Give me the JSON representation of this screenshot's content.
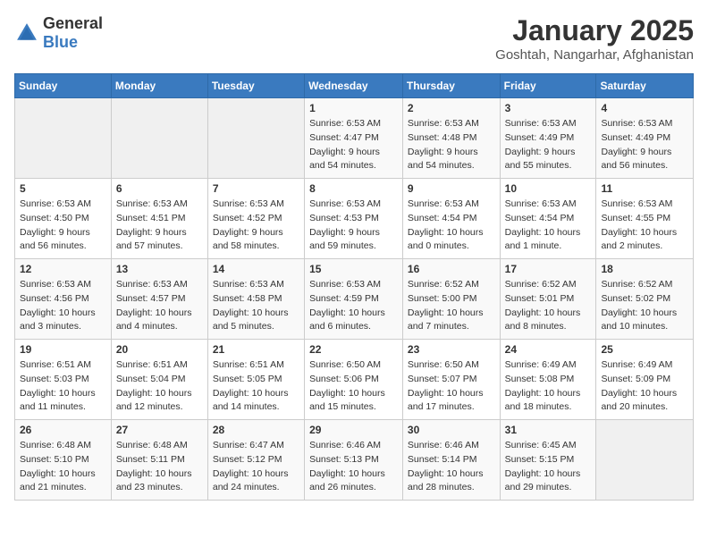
{
  "logo": {
    "general": "General",
    "blue": "Blue"
  },
  "title": "January 2025",
  "subtitle": "Goshtah, Nangarhar, Afghanistan",
  "headers": [
    "Sunday",
    "Monday",
    "Tuesday",
    "Wednesday",
    "Thursday",
    "Friday",
    "Saturday"
  ],
  "weeks": [
    [
      {
        "day": "",
        "info": ""
      },
      {
        "day": "",
        "info": ""
      },
      {
        "day": "",
        "info": ""
      },
      {
        "day": "1",
        "info": "Sunrise: 6:53 AM\nSunset: 4:47 PM\nDaylight: 9 hours\nand 54 minutes."
      },
      {
        "day": "2",
        "info": "Sunrise: 6:53 AM\nSunset: 4:48 PM\nDaylight: 9 hours\nand 54 minutes."
      },
      {
        "day": "3",
        "info": "Sunrise: 6:53 AM\nSunset: 4:49 PM\nDaylight: 9 hours\nand 55 minutes."
      },
      {
        "day": "4",
        "info": "Sunrise: 6:53 AM\nSunset: 4:49 PM\nDaylight: 9 hours\nand 56 minutes."
      }
    ],
    [
      {
        "day": "5",
        "info": "Sunrise: 6:53 AM\nSunset: 4:50 PM\nDaylight: 9 hours\nand 56 minutes."
      },
      {
        "day": "6",
        "info": "Sunrise: 6:53 AM\nSunset: 4:51 PM\nDaylight: 9 hours\nand 57 minutes."
      },
      {
        "day": "7",
        "info": "Sunrise: 6:53 AM\nSunset: 4:52 PM\nDaylight: 9 hours\nand 58 minutes."
      },
      {
        "day": "8",
        "info": "Sunrise: 6:53 AM\nSunset: 4:53 PM\nDaylight: 9 hours\nand 59 minutes."
      },
      {
        "day": "9",
        "info": "Sunrise: 6:53 AM\nSunset: 4:54 PM\nDaylight: 10 hours\nand 0 minutes."
      },
      {
        "day": "10",
        "info": "Sunrise: 6:53 AM\nSunset: 4:54 PM\nDaylight: 10 hours\nand 1 minute."
      },
      {
        "day": "11",
        "info": "Sunrise: 6:53 AM\nSunset: 4:55 PM\nDaylight: 10 hours\nand 2 minutes."
      }
    ],
    [
      {
        "day": "12",
        "info": "Sunrise: 6:53 AM\nSunset: 4:56 PM\nDaylight: 10 hours\nand 3 minutes."
      },
      {
        "day": "13",
        "info": "Sunrise: 6:53 AM\nSunset: 4:57 PM\nDaylight: 10 hours\nand 4 minutes."
      },
      {
        "day": "14",
        "info": "Sunrise: 6:53 AM\nSunset: 4:58 PM\nDaylight: 10 hours\nand 5 minutes."
      },
      {
        "day": "15",
        "info": "Sunrise: 6:53 AM\nSunset: 4:59 PM\nDaylight: 10 hours\nand 6 minutes."
      },
      {
        "day": "16",
        "info": "Sunrise: 6:52 AM\nSunset: 5:00 PM\nDaylight: 10 hours\nand 7 minutes."
      },
      {
        "day": "17",
        "info": "Sunrise: 6:52 AM\nSunset: 5:01 PM\nDaylight: 10 hours\nand 8 minutes."
      },
      {
        "day": "18",
        "info": "Sunrise: 6:52 AM\nSunset: 5:02 PM\nDaylight: 10 hours\nand 10 minutes."
      }
    ],
    [
      {
        "day": "19",
        "info": "Sunrise: 6:51 AM\nSunset: 5:03 PM\nDaylight: 10 hours\nand 11 minutes."
      },
      {
        "day": "20",
        "info": "Sunrise: 6:51 AM\nSunset: 5:04 PM\nDaylight: 10 hours\nand 12 minutes."
      },
      {
        "day": "21",
        "info": "Sunrise: 6:51 AM\nSunset: 5:05 PM\nDaylight: 10 hours\nand 14 minutes."
      },
      {
        "day": "22",
        "info": "Sunrise: 6:50 AM\nSunset: 5:06 PM\nDaylight: 10 hours\nand 15 minutes."
      },
      {
        "day": "23",
        "info": "Sunrise: 6:50 AM\nSunset: 5:07 PM\nDaylight: 10 hours\nand 17 minutes."
      },
      {
        "day": "24",
        "info": "Sunrise: 6:49 AM\nSunset: 5:08 PM\nDaylight: 10 hours\nand 18 minutes."
      },
      {
        "day": "25",
        "info": "Sunrise: 6:49 AM\nSunset: 5:09 PM\nDaylight: 10 hours\nand 20 minutes."
      }
    ],
    [
      {
        "day": "26",
        "info": "Sunrise: 6:48 AM\nSunset: 5:10 PM\nDaylight: 10 hours\nand 21 minutes."
      },
      {
        "day": "27",
        "info": "Sunrise: 6:48 AM\nSunset: 5:11 PM\nDaylight: 10 hours\nand 23 minutes."
      },
      {
        "day": "28",
        "info": "Sunrise: 6:47 AM\nSunset: 5:12 PM\nDaylight: 10 hours\nand 24 minutes."
      },
      {
        "day": "29",
        "info": "Sunrise: 6:46 AM\nSunset: 5:13 PM\nDaylight: 10 hours\nand 26 minutes."
      },
      {
        "day": "30",
        "info": "Sunrise: 6:46 AM\nSunset: 5:14 PM\nDaylight: 10 hours\nand 28 minutes."
      },
      {
        "day": "31",
        "info": "Sunrise: 6:45 AM\nSunset: 5:15 PM\nDaylight: 10 hours\nand 29 minutes."
      },
      {
        "day": "",
        "info": ""
      }
    ]
  ]
}
